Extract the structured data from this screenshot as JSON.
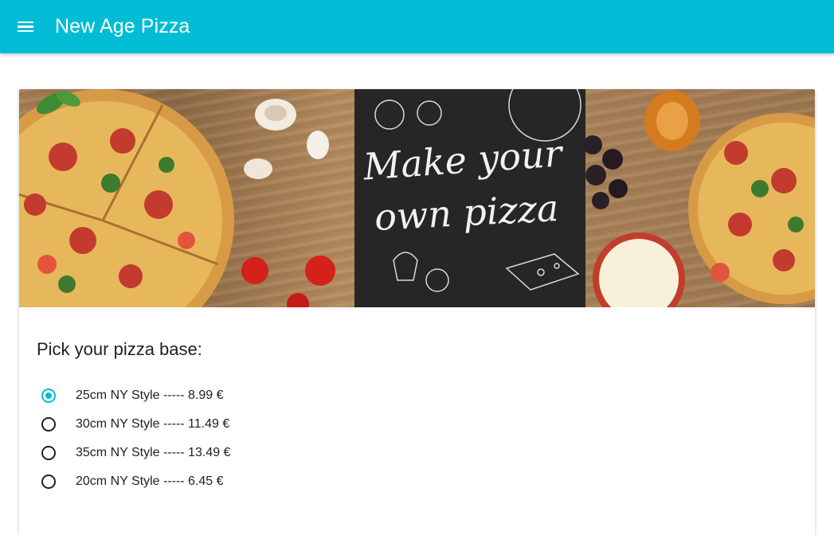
{
  "app": {
    "title": "New Age Pizza",
    "accent_color": "#00bcd4"
  },
  "banner": {
    "line1": "Make your",
    "line2": "own pizza"
  },
  "base_picker": {
    "heading": "Pick your pizza base:",
    "selected_index": 0,
    "options": [
      {
        "label": "25cm NY Style ----- 8.99 €"
      },
      {
        "label": "30cm NY Style ----- 11.49 €"
      },
      {
        "label": "35cm NY Style ----- 13.49 €"
      },
      {
        "label": "20cm NY Style ----- 6.45 €"
      }
    ]
  }
}
